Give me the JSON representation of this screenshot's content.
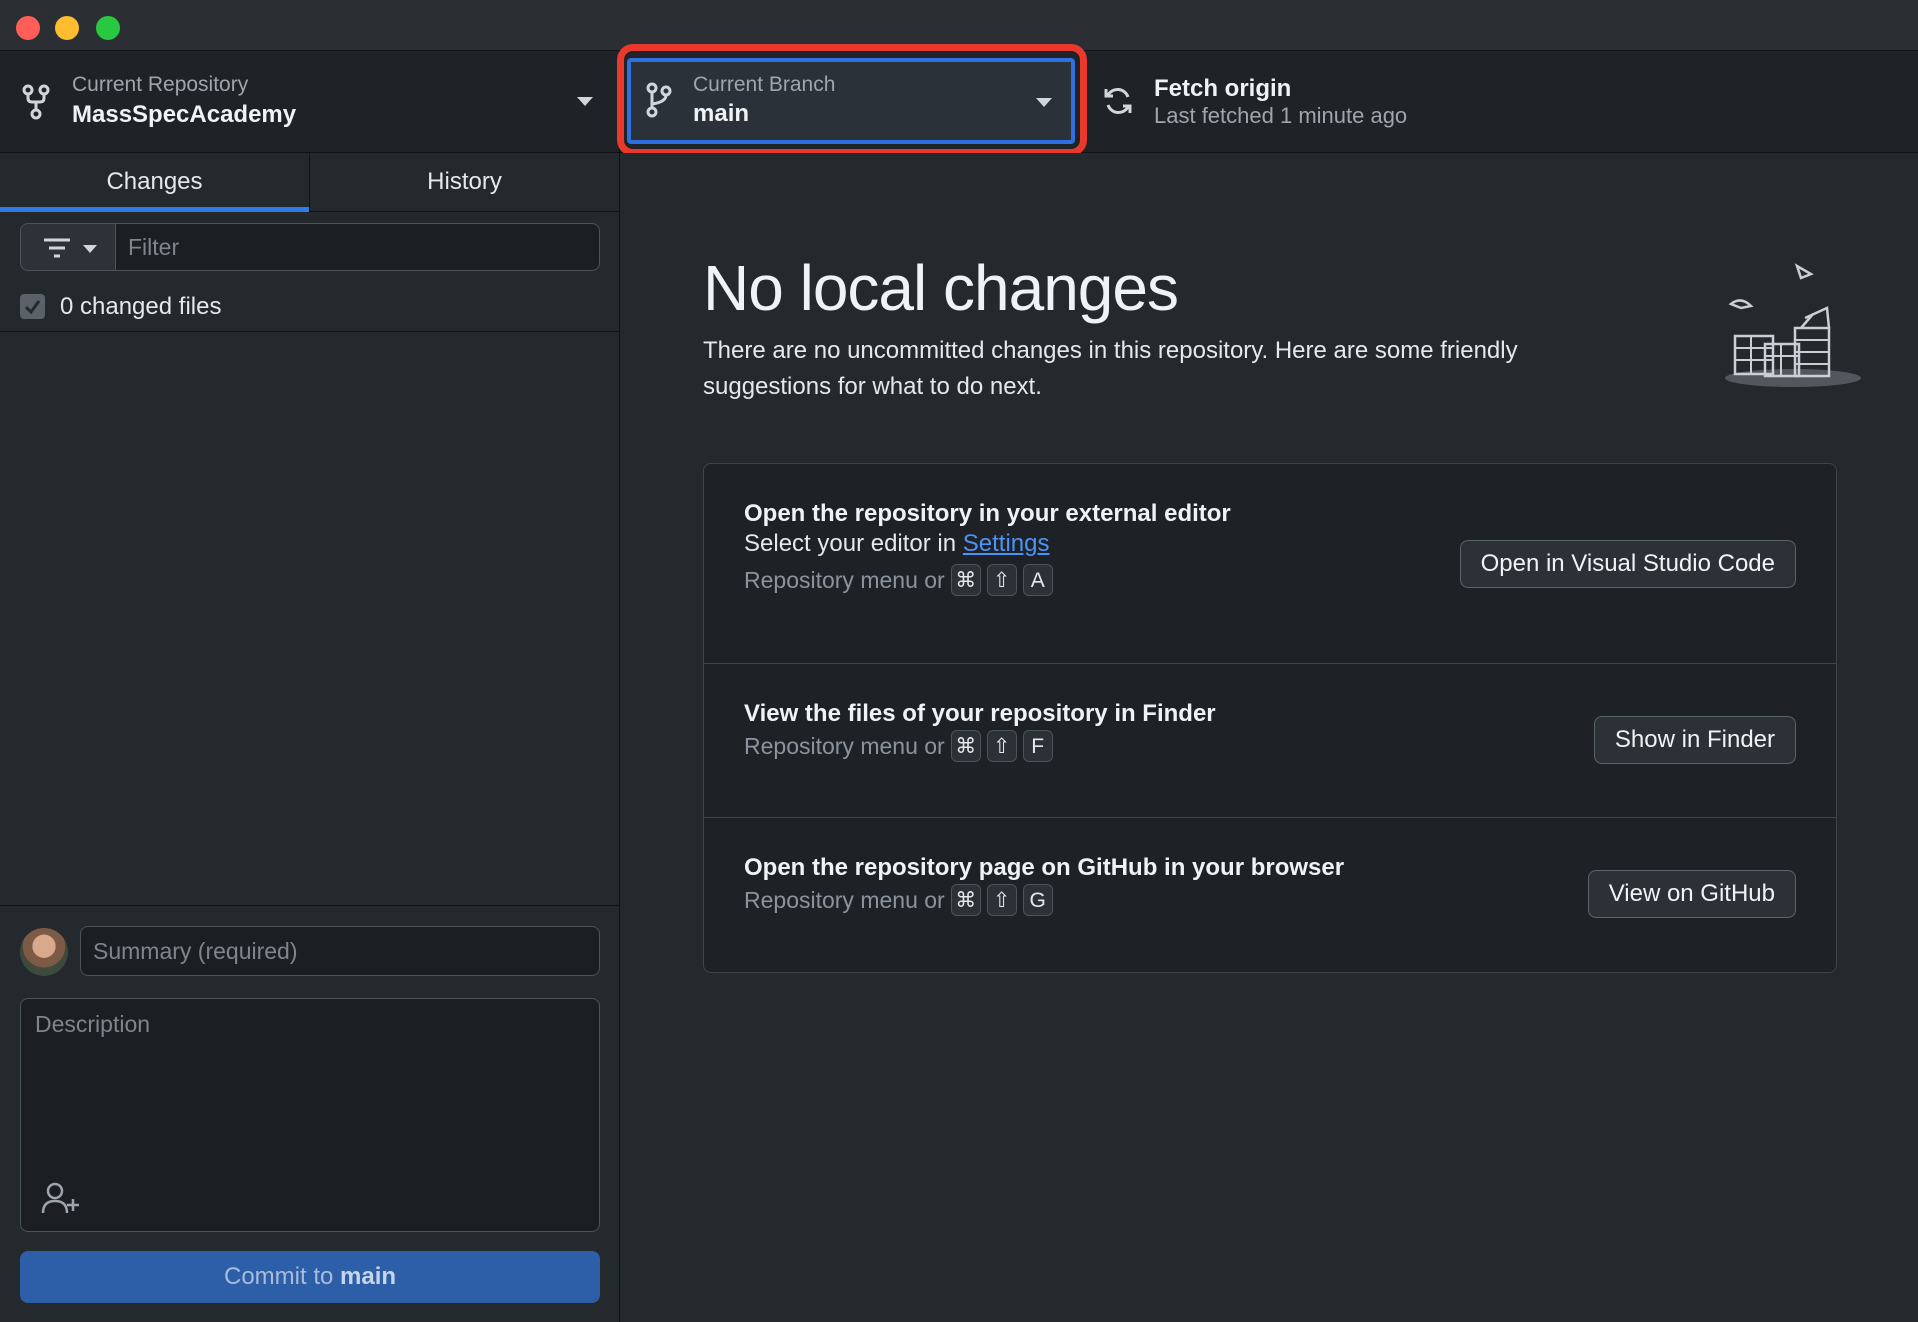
{
  "toolbar": {
    "repo_label": "Current Repository",
    "repo_value": "MassSpecAcademy",
    "branch_label": "Current Branch",
    "branch_value": "main",
    "fetch_title": "Fetch origin",
    "fetch_sub": "Last fetched 1 minute ago"
  },
  "sidebar": {
    "tabs": [
      {
        "label": "Changes",
        "selected": true
      },
      {
        "label": "History",
        "selected": false
      }
    ],
    "filter_placeholder": "Filter",
    "changed_files": "0 changed files",
    "summary_placeholder": "Summary (required)",
    "description_placeholder": "Description",
    "commit_prefix": "Commit to ",
    "commit_branch": "main"
  },
  "main": {
    "title": "No local changes",
    "description": "There are no uncommitted changes in this repository. Here are some friendly suggestions for what to do next.",
    "cards": [
      {
        "title": "Open the repository in your external editor",
        "subtitle_prefix": "Select your editor in ",
        "subtitle_link": "Settings",
        "shortcut_prefix": "Repository menu or",
        "keys": [
          "⌘",
          "⇧",
          "A"
        ],
        "button": "Open in Visual Studio Code"
      },
      {
        "title": "View the files of your repository in Finder",
        "shortcut_prefix": "Repository menu or",
        "keys": [
          "⌘",
          "⇧",
          "F"
        ],
        "button": "Show in Finder"
      },
      {
        "title": "Open the repository page on GitHub in your browser",
        "shortcut_prefix": "Repository menu or",
        "keys": [
          "⌘",
          "⇧",
          "G"
        ],
        "button": "View on GitHub"
      }
    ]
  },
  "colors": {
    "accent": "#2f7be8",
    "highlight": "#e8392c",
    "link": "#4b94f7",
    "commit_button": "#2d5ea8"
  }
}
